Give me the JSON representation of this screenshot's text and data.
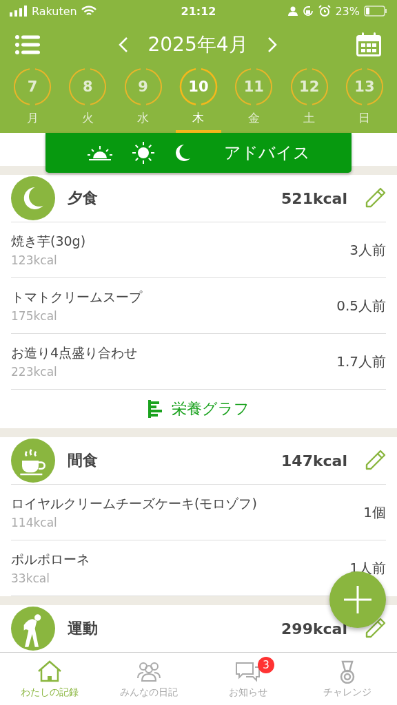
{
  "status_bar": {
    "carrier": "Rakuten",
    "time": "21:12",
    "battery": "23%"
  },
  "header": {
    "month": "2025年4月"
  },
  "days": [
    {
      "day": "7",
      "weekday": "月",
      "selected": false
    },
    {
      "day": "8",
      "weekday": "火",
      "selected": false
    },
    {
      "day": "9",
      "weekday": "水",
      "selected": false
    },
    {
      "day": "10",
      "weekday": "木",
      "selected": true
    },
    {
      "day": "11",
      "weekday": "金",
      "selected": false
    },
    {
      "day": "12",
      "weekday": "土",
      "selected": false
    },
    {
      "day": "13",
      "weekday": "日",
      "selected": false
    }
  ],
  "advice_bar": {
    "label": "アドバイス"
  },
  "sections": [
    {
      "kind": "dinner",
      "title": "夕食",
      "kcal": "521kcal",
      "items": [
        {
          "name": "焼き芋(30g)",
          "kcal": "123kcal",
          "amount": "3人前"
        },
        {
          "name": "トマトクリームスープ",
          "kcal": "175kcal",
          "amount": "0.5人前"
        },
        {
          "name": "お造り4点盛り合わせ",
          "kcal": "223kcal",
          "amount": "1.7人前"
        }
      ],
      "graph_link": "栄養グラフ"
    },
    {
      "kind": "snack",
      "title": "間食",
      "kcal": "147kcal",
      "items": [
        {
          "name": "ロイヤルクリームチーズケーキ(モロゾフ)",
          "kcal": "114kcal",
          "amount": "1個"
        },
        {
          "name": "ポルポローネ",
          "kcal": "33kcal",
          "amount": "1人前"
        }
      ]
    },
    {
      "kind": "exercise",
      "title": "運動",
      "kcal": "299kcal"
    }
  ],
  "tab_bar": [
    {
      "kind": "home",
      "label": "わたしの記録",
      "selected": true
    },
    {
      "kind": "people",
      "label": "みんなの日記",
      "selected": false
    },
    {
      "kind": "chat",
      "label": "お知らせ",
      "selected": false,
      "badge": "3"
    },
    {
      "kind": "medal",
      "label": "チャレンジ",
      "selected": false
    }
  ]
}
